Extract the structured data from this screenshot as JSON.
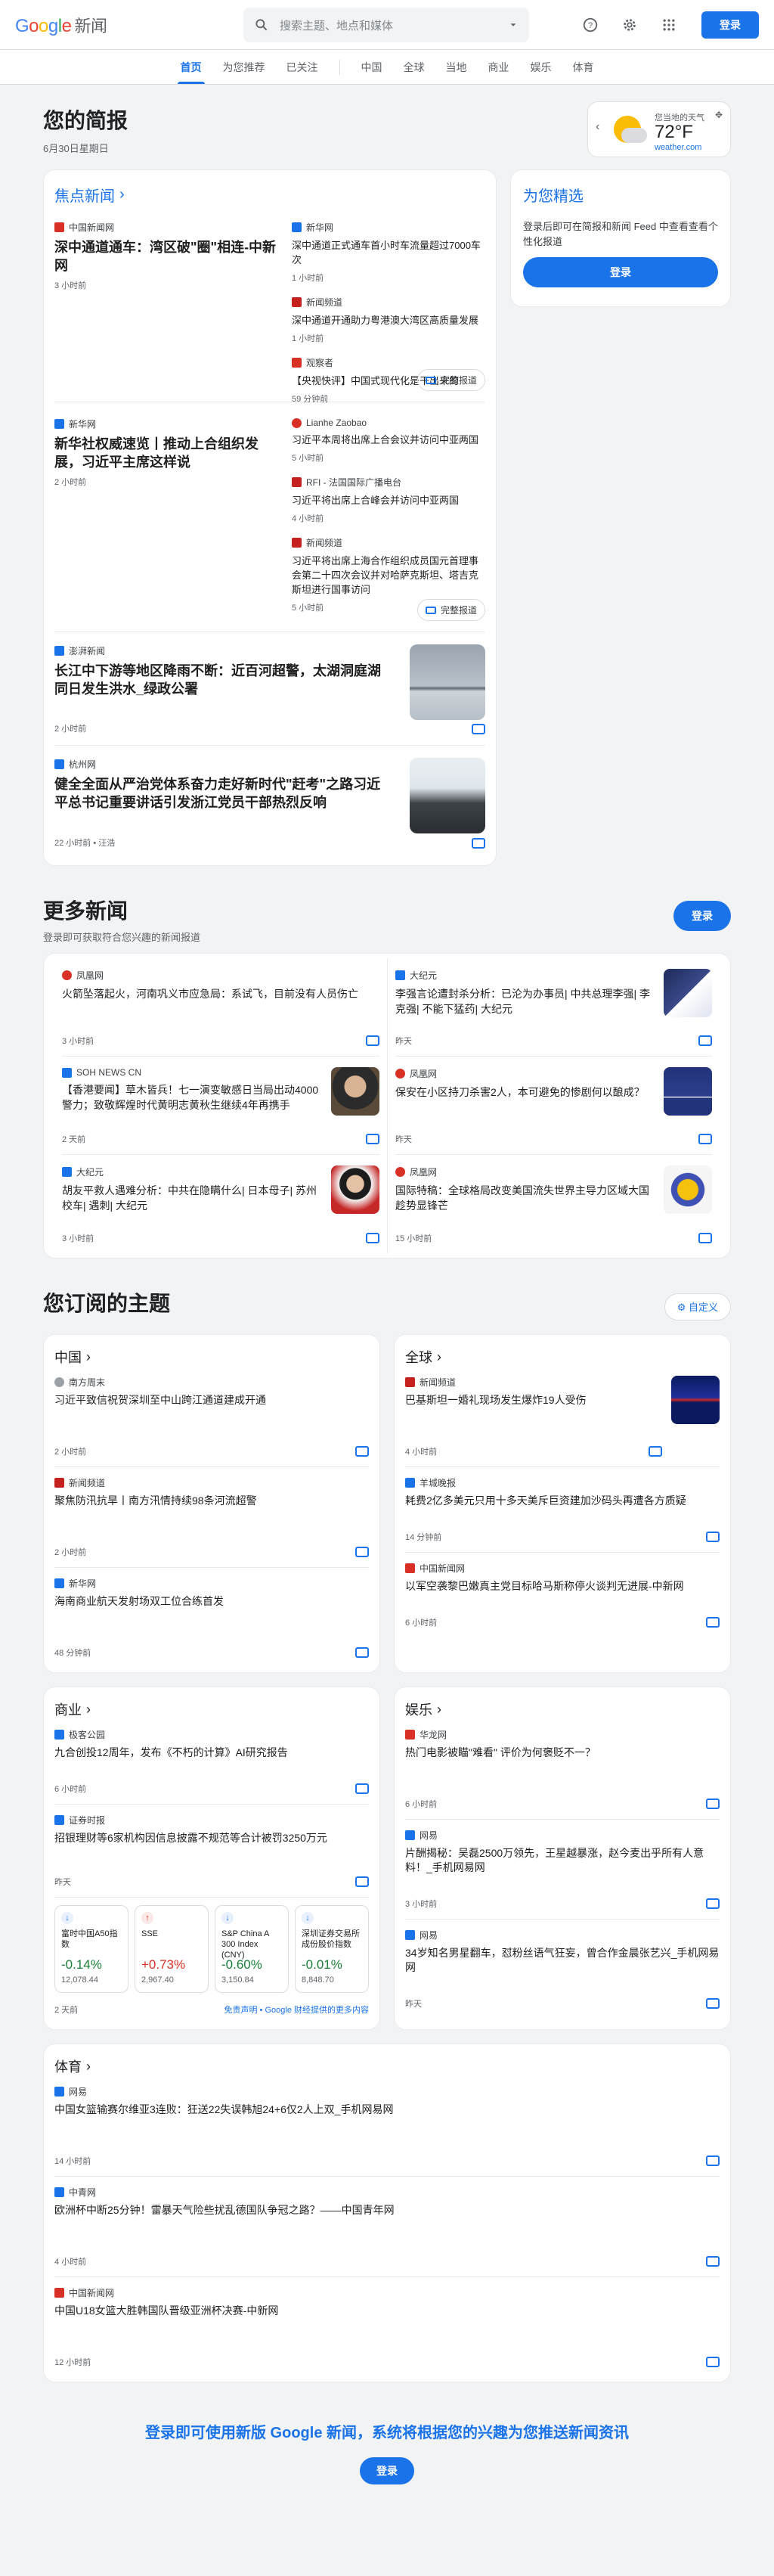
{
  "header": {
    "logo_parts": [
      "G",
      "o",
      "o",
      "g",
      "l",
      "e"
    ],
    "logo_suffix": "新闻",
    "search_placeholder": "搜索主题、地点和媒体",
    "signin_label": "登录"
  },
  "nav": {
    "tabs": [
      "首页",
      "为您推荐",
      "已关注",
      "中国",
      "全球",
      "当地",
      "商业",
      "娱乐",
      "体育"
    ],
    "active": "首页"
  },
  "briefing": {
    "title": "您的简报",
    "date": "6月30日星期日"
  },
  "weather": {
    "label": "您当地的天气",
    "temp": "72°F",
    "source": "weather.com"
  },
  "top_stories": {
    "title": "焦点新闻",
    "full_coverage_label": "完整报道",
    "clusters": [
      {
        "main": {
          "source": "中国新闻网",
          "headline": "深中通道通车：湾区破\"圈\"相连-中新网",
          "time": "3 小时前",
          "color": "#d93025"
        },
        "side": [
          {
            "source": "新华网",
            "headline": "深中通道正式通车首小时车流量超过7000车次",
            "time": "1 小时前",
            "color": "#1a73e8"
          },
          {
            "source": "新闻频道",
            "headline": "深中通道开通助力粤港澳大湾区高质量发展",
            "time": "1 小时前",
            "color": "#c5221f"
          },
          {
            "source": "观察者",
            "headline": "【央视快评】中国式现代化是干出来的",
            "time": "59 分钟前",
            "color": "#d93025"
          }
        ]
      },
      {
        "main": {
          "source": "新华网",
          "headline": "新华社权威速览丨推动上合组织发展，习近平主席这样说",
          "time": "2 小时前",
          "color": "#1a73e8"
        },
        "side": [
          {
            "source": "Lianhe Zaobao",
            "headline": "习近平本周将出席上合会议并访问中亚两国",
            "time": "5 小时前",
            "color": "#d93025"
          },
          {
            "source": "RFI - 法国国际广播电台",
            "headline": "习近平将出席上合峰会并访问中亚两国",
            "time": "4 小时前",
            "color": "#c5221f"
          },
          {
            "source": "新闻频道",
            "headline": "习近平将出席上海合作组织成员国元首理事会第二十四次会议并对哈萨克斯坦、塔吉克斯坦进行国事访问",
            "time": "5 小时前",
            "color": "#c5221f"
          }
        ]
      }
    ],
    "singles": [
      {
        "source": "澎湃新闻",
        "headline": "长江中下游等地区降雨不断：近百河超警，太湖洞庭湖同日发生洪水_绿政公署",
        "time": "2 小时前",
        "color": "#1a73e8"
      },
      {
        "source": "杭州网",
        "headline": "健全全面从严治党体系奋力走好新时代\"赶考\"之路习近平总书记重要讲话引发浙江党员干部热烈反响",
        "time": "22 小时前 • 汪浩",
        "color": "#1a73e8"
      }
    ]
  },
  "picks": {
    "title": "为您精选",
    "desc": "登录后即可在简报和新闻 Feed 中查看查看个性化报道",
    "button": "登录"
  },
  "more_news": {
    "title": "更多新闻",
    "subtitle": "登录即可获取符合您兴趣的新闻报道",
    "button": "登录",
    "left": [
      {
        "source": "凤凰网",
        "headline": "火箭坠落起火，河南巩义市应急局：系试飞，目前没有人员伤亡",
        "time": "3 小时前",
        "color": "#d93025",
        "thumb": false
      },
      {
        "source": "SOH NEWS CN",
        "headline": "【香港要闻】草木皆兵！七一演变敏感日当局出动4000警力；致敬辉煌时代黄明志黄秋生继续4年再携手",
        "time": "2 天前",
        "color": "#1a73e8",
        "thumb": true
      },
      {
        "source": "大纪元",
        "headline": "胡友平救人遇难分析：中共在隐瞒什么| 日本母子| 苏州校车| 遇刺| 大纪元",
        "time": "3 小时前",
        "color": "#1a73e8",
        "thumb": true
      }
    ],
    "right": [
      {
        "source": "大纪元",
        "headline": "李强言论遭封杀分析：已沦为办事员| 中共总理李强| 李克强| 不能下猛药| 大纪元",
        "time": "昨天",
        "color": "#1a73e8",
        "thumb": true
      },
      {
        "source": "凤凰网",
        "headline": "保安在小区持刀杀害2人，本可避免的惨剧何以酿成？",
        "time": "昨天",
        "color": "#d93025",
        "thumb": true
      },
      {
        "source": "凤凰网",
        "headline": "国际特稿：全球格局改变美国流失世界主导力区域大国趁势显锋芒",
        "time": "15 小时前",
        "color": "#d93025",
        "thumb": true
      }
    ]
  },
  "topics": {
    "title": "您订阅的主题",
    "customize": "自定义",
    "china": {
      "title": "中国",
      "items": [
        {
          "source": "南方周末",
          "headline": "习近平致信祝贺深圳至中山跨江通道建成开通",
          "time": "2 小时前",
          "color": "#9aa0a6",
          "thumb": false
        },
        {
          "source": "新闻频道",
          "headline": "聚焦防汛抗旱丨南方汛情持续98条河流超警",
          "time": "2 小时前",
          "color": "#c5221f",
          "thumb": false
        },
        {
          "source": "新华网",
          "headline": "海南商业航天发射场双工位合练首发",
          "time": "48 分钟前",
          "color": "#1a73e8",
          "thumb": false
        }
      ]
    },
    "world": {
      "title": "全球",
      "items": [
        {
          "source": "新闻频道",
          "headline": "巴基斯坦一婚礼现场发生爆炸19人受伤",
          "time": "4 小时前",
          "color": "#c5221f",
          "thumb": true
        },
        {
          "source": "羊城晚报",
          "headline": "耗费2亿多美元只用十多天美斥巨资建加沙码头再遭各方质疑",
          "time": "14 分钟前",
          "color": "#1a73e8",
          "thumb": false
        },
        {
          "source": "中国新闻网",
          "headline": "以军空袭黎巴嫩真主党目标哈马斯称停火谈判无进展-中新网",
          "time": "6 小时前",
          "color": "#d93025",
          "thumb": false
        }
      ]
    },
    "business": {
      "title": "商业",
      "items": [
        {
          "source": "极客公园",
          "headline": "九合创投12周年，发布《不朽的计算》AI研究报告",
          "time": "6 小时前",
          "color": "#1a73e8",
          "thumb": false
        },
        {
          "source": "证券时报",
          "headline": "招银理财等6家机构因信息披露不规范等合计被罚3250万元",
          "time": "昨天",
          "color": "#1a73e8",
          "thumb": false
        }
      ],
      "stocks": [
        {
          "name": "富时中国A50指数",
          "pct": "-0.14%",
          "value": "12,078.44",
          "color": "#188038"
        },
        {
          "name": "SSE",
          "pct": "+0.73%",
          "value": "2,967.40",
          "color": "#d93025"
        },
        {
          "name": "S&P China A 300 Index (CNY)",
          "pct": "-0.60%",
          "value": "3,150.84",
          "color": "#188038"
        },
        {
          "name": "深圳证券交易所成份股价指数",
          "pct": "-0.01%",
          "value": "8,848.70",
          "color": "#188038"
        }
      ],
      "stocks_time": "2 天前",
      "disclaimer": "免责声明 • Google 财经提供的更多内容"
    },
    "entertainment": {
      "title": "娱乐",
      "items": [
        {
          "source": "华龙网",
          "headline": "热门电影被瞄\"难看\" 评价为何褒贬不一？",
          "time": "6 小时前",
          "color": "#d93025",
          "thumb": false
        },
        {
          "source": "网易",
          "headline": "片酬揭秘：吴磊2500万领先，王星越暴涨，赵今麦出乎所有人意料！_手机网易网",
          "time": "3 小时前",
          "color": "#1a73e8",
          "thumb": false
        },
        {
          "source": "网易",
          "headline": "34岁知名男星翻车，怼粉丝语气狂妄，曾合作金晨张艺兴_手机网易网",
          "time": "昨天",
          "color": "#1a73e8",
          "thumb": false
        }
      ]
    },
    "sports": {
      "title": "体育",
      "items": [
        {
          "source": "网易",
          "headline": "中国女篮输赛尔维亚3连败：狂送22失误韩旭24+6仅2人上双_手机网易网",
          "time": "14 小时前",
          "color": "#1a73e8"
        },
        {
          "source": "中青网",
          "headline": "欧洲杯中断25分钟！雷暴天气险些扰乱德国队争冠之路？——中国青年网",
          "time": "4 小时前",
          "color": "#1a73e8"
        },
        {
          "source": "中国新闻网",
          "headline": "中国U18女篮大胜韩国队晋级亚洲杯决赛-中新网",
          "time": "12 小时前",
          "color": "#d93025"
        }
      ]
    }
  },
  "bottom": {
    "text": "登录即可使用新版 Google 新闻，系统将根据您的兴趣为您推送新闻资讯",
    "button": "登录"
  }
}
